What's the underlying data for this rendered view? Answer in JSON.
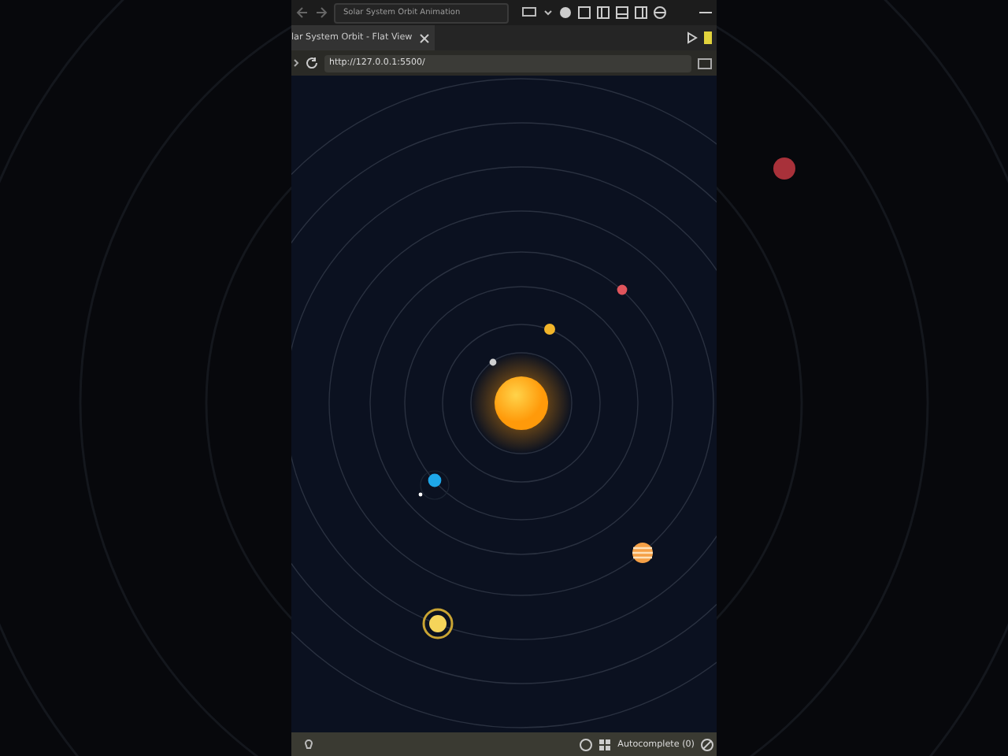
{
  "browser": {
    "title_field": "Solar System Orbit Animation",
    "tab": {
      "label": "lar System Orbit - Flat View"
    },
    "url": "http://127.0.0.1:5500/"
  },
  "status_bar": {
    "autocomplete": "Autocomplete (0)"
  }
}
